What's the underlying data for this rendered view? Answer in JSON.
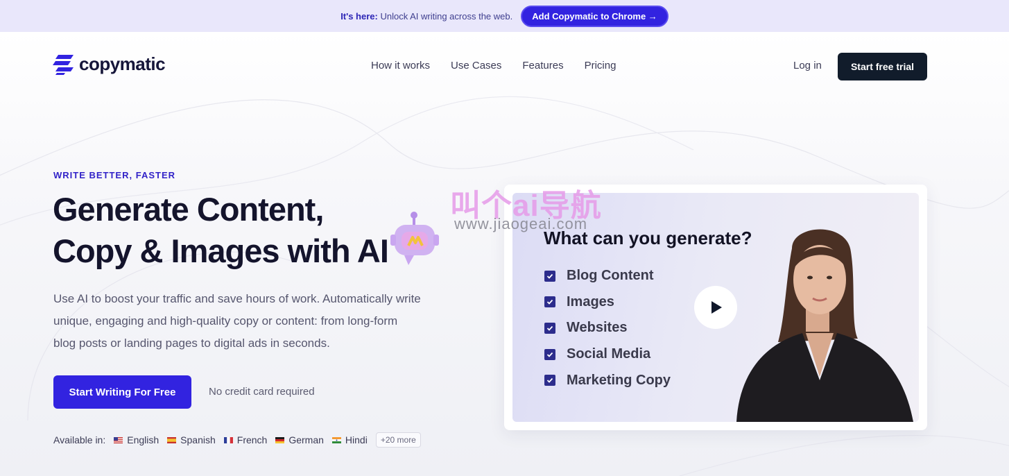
{
  "announcement": {
    "label": "It's here:",
    "message": "Unlock AI writing across the web.",
    "cta": "Add Copymatic to Chrome →"
  },
  "brand": {
    "name": "copymatic"
  },
  "nav": {
    "items": [
      {
        "label": "How it works"
      },
      {
        "label": "Use Cases"
      },
      {
        "label": "Features"
      },
      {
        "label": "Pricing"
      }
    ],
    "login": "Log in",
    "trial": "Start free trial"
  },
  "hero": {
    "eyebrow": "WRITE BETTER, FASTER",
    "headline_line1": "Generate Content,",
    "headline_line2": "Copy & Images with AI",
    "subtitle": "Use AI to boost your traffic and save hours of work. Automatically write unique, engaging and high-quality copy or content: from long-form blog posts or landing pages to digital ads in seconds.",
    "cta": "Start Writing For Free",
    "note": "No credit card required",
    "available_label": "Available in:",
    "languages": [
      {
        "name": "English"
      },
      {
        "name": "Spanish"
      },
      {
        "name": "French"
      },
      {
        "name": "German"
      },
      {
        "name": "Hindi"
      }
    ],
    "more": "+20 more"
  },
  "video": {
    "question": "What can you generate?",
    "items": [
      {
        "label": "Blog Content"
      },
      {
        "label": "Images"
      },
      {
        "label": "Websites"
      },
      {
        "label": "Social Media"
      },
      {
        "label": "Marketing Copy"
      }
    ]
  },
  "watermark": {
    "text": "叫个ai导航",
    "url": "www.jiaogeai.com"
  },
  "colors": {
    "accent": "#3223e0",
    "dark_button": "#111c2b",
    "announce_bg": "#e9e7fb"
  },
  "icons": [
    "logo-mark-icon",
    "play-icon",
    "checkbox-icon",
    "flag-icon",
    "robot-icon"
  ]
}
